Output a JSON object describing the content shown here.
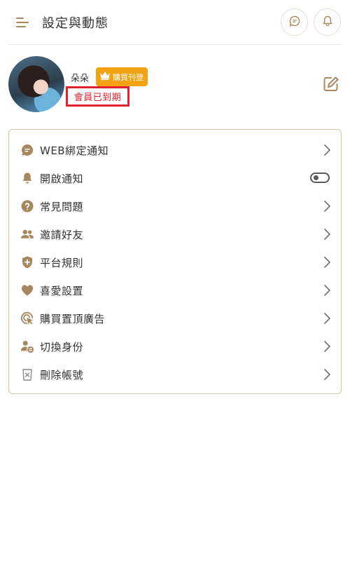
{
  "header": {
    "title": "設定與動態",
    "icons": {
      "menu": "menu-icon",
      "chat": "chat-icon",
      "bell": "bell-icon"
    }
  },
  "profile": {
    "username": "朵朵",
    "badge_label": "購買刊登",
    "badge_icon": "crown-icon",
    "status": "會員已到期",
    "status_color": "#e0222c",
    "edit_icon": "edit-icon"
  },
  "menu": {
    "items": [
      {
        "label": "WEB綁定通知",
        "icon": "chat-bubble-icon",
        "trailing": "chevron"
      },
      {
        "label": "開啟通知",
        "icon": "bell-icon",
        "trailing": "toggle",
        "toggle_on": false
      },
      {
        "label": "常見問題",
        "icon": "question-icon",
        "trailing": "chevron"
      },
      {
        "label": "邀請好友",
        "icon": "users-icon",
        "trailing": "chevron"
      },
      {
        "label": "平台規則",
        "icon": "shield-plus-icon",
        "trailing": "chevron"
      },
      {
        "label": "喜愛設置",
        "icon": "heart-icon",
        "trailing": "chevron"
      },
      {
        "label": "購買置頂廣告",
        "icon": "cursor-target-icon",
        "trailing": "chevron"
      },
      {
        "label": "切換身份",
        "icon": "switch-user-icon",
        "trailing": "chevron"
      },
      {
        "label": "刪除帳號",
        "icon": "delete-box-icon",
        "trailing": "chevron"
      }
    ]
  },
  "colors": {
    "accent": "#a8875f",
    "badge": "#f2a213",
    "card_border": "#d9c3a8"
  }
}
